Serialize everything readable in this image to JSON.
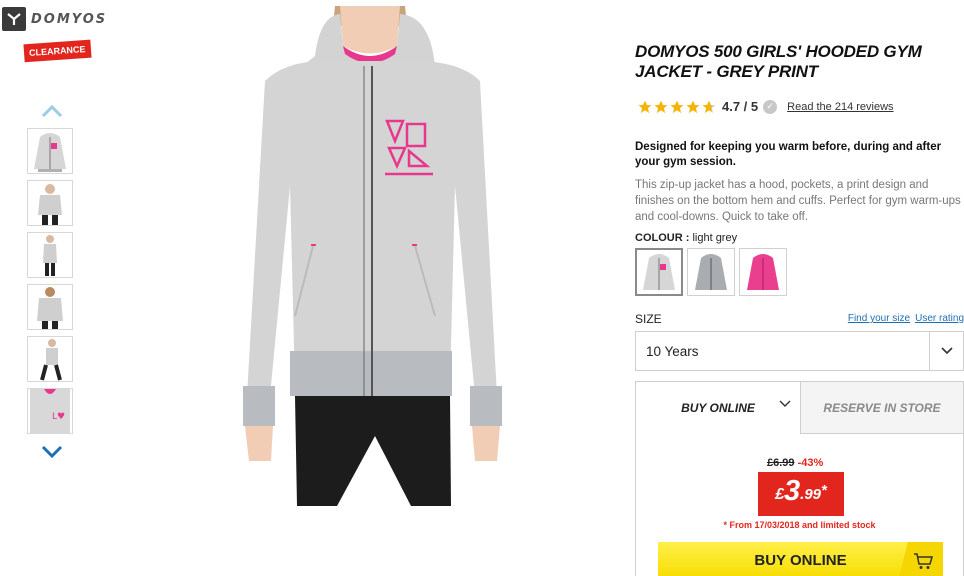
{
  "brand": {
    "name": "DOMYOS"
  },
  "badge": {
    "label": "CLEARANCE"
  },
  "product": {
    "title": "DOMYOS 500 GIRLS' HOODED GYM JACKET - GREY PRINT",
    "rating": {
      "stars": 4.7,
      "max": 5,
      "text": "4.7 / 5",
      "reviews_link": "Read the 214 reviews"
    },
    "description_bold": "Designed for keeping you warm before, during and after your gym session.",
    "description": "This zip-up jacket has a hood, pockets, a print design and finishes on the bottom hem and cuffs. Perfect for gym warm-ups and cool-downs. Quick to take off.",
    "colour": {
      "label": "COLOUR :",
      "value": "light grey",
      "options": [
        "light grey",
        "grey",
        "pink"
      ]
    },
    "size": {
      "label": "SIZE",
      "find_size": "Find your size",
      "user_rating": "User rating",
      "selected": "10 Years"
    },
    "purchase": {
      "tab_online": "BUY ONLINE",
      "tab_store": "RESERVE IN STORE",
      "old_price": "£6.99",
      "discount": "-43%",
      "price_currency": "£",
      "price_int": "3",
      "price_dec": ".99",
      "price_asterisk": "*",
      "note": "* From 17/03/2018 and limited stock",
      "buy_button": "BUY ONLINE"
    }
  },
  "colors": {
    "accent_red": "#e3261d",
    "buy_yellow": "#f7dd00",
    "link_blue": "#1f6fb5",
    "star": "#f5b400"
  }
}
